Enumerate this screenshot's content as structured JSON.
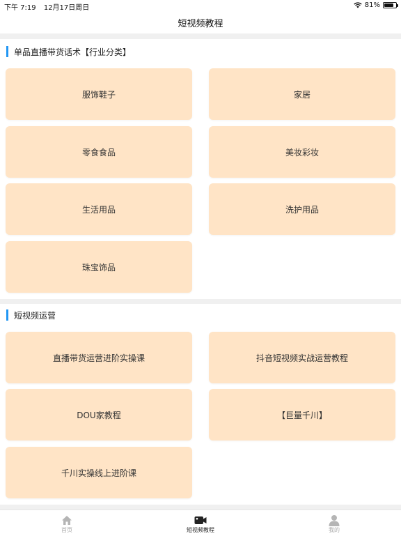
{
  "status_bar": {
    "time": "下午 7:19",
    "date": "12月17日周日",
    "battery_text": "81%",
    "battery_level": 0.81
  },
  "nav": {
    "title": "短视频教程"
  },
  "sections": [
    {
      "title": "单品直播带货话术【行业分类】",
      "items": [
        "服饰鞋子",
        "家居",
        "零食食品",
        "美妆彩妆",
        "生活用品",
        "洗护用品",
        "珠宝饰品"
      ]
    },
    {
      "title": "短视频运营",
      "items": [
        "直播带货运营进阶实操课",
        "抖音短视频实战运营教程",
        "DOU家教程",
        "【巨量千川】",
        "千川实操线上进阶课"
      ]
    }
  ],
  "tabs": [
    {
      "label": "首页",
      "icon": "home-icon"
    },
    {
      "label": "短视频教程",
      "icon": "video-camera-icon"
    },
    {
      "label": "我的",
      "icon": "user-icon"
    }
  ],
  "colors": {
    "card_bg": "#ffe4c6",
    "accent_bar": "#2196f3"
  }
}
